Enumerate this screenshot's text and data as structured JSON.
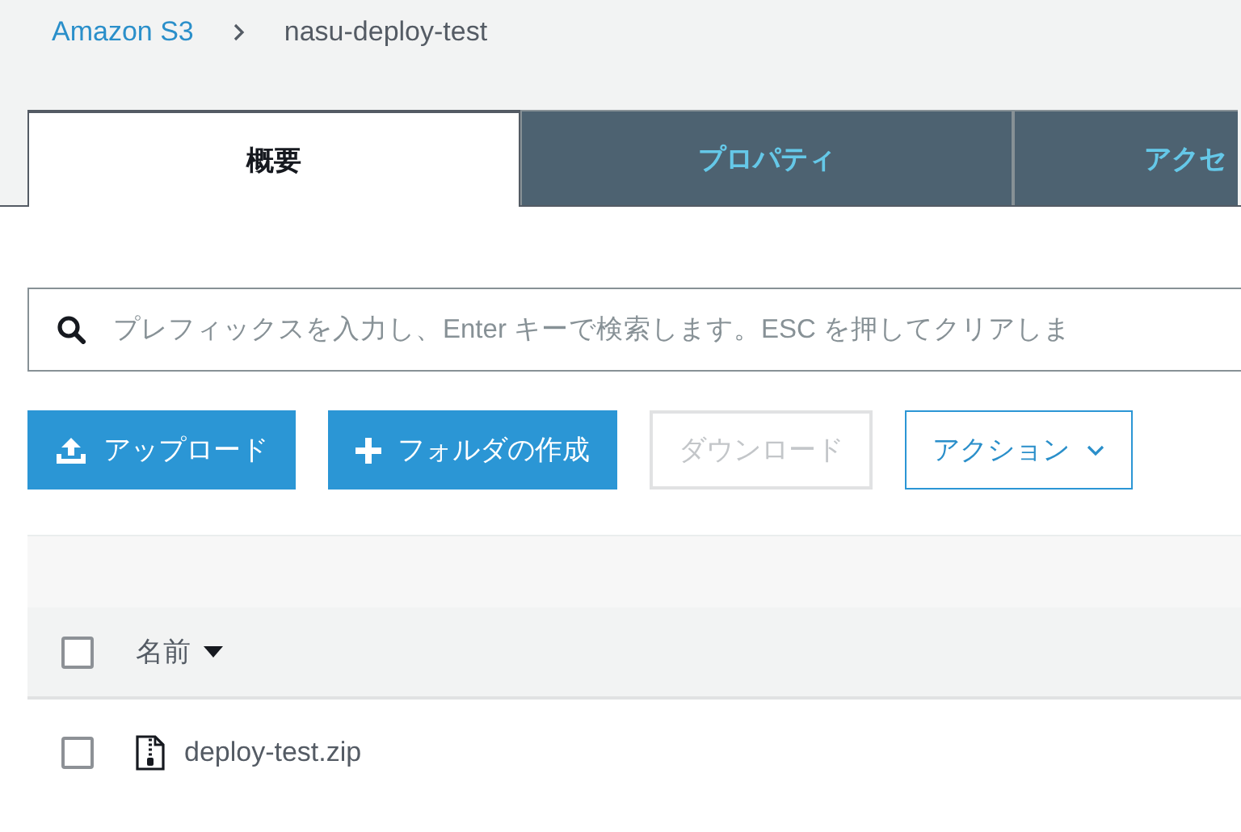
{
  "breadcrumb": [
    {
      "label": "Amazon S3",
      "kind": "link"
    },
    {
      "label": "nasu-deploy-test",
      "kind": "current"
    }
  ],
  "tabs": [
    {
      "label": "概要",
      "selected": true
    },
    {
      "label": "プロパティ",
      "selected": false
    },
    {
      "label": "アクセ",
      "selected": false
    }
  ],
  "search": {
    "placeholder": "プレフィックスを入力し、Enter キーで検索します。ESC を押してクリアしま"
  },
  "buttons": [
    {
      "label": "アップロード",
      "kind": "upload",
      "disabled": false
    },
    {
      "label": "フォルダの作成",
      "kind": "create",
      "disabled": false
    },
    {
      "label": "ダウンロード",
      "kind": "plain",
      "disabled": true
    },
    {
      "label": "アクション",
      "kind": "menu",
      "disabled": false
    }
  ],
  "table": {
    "select_all": {
      "checked": false
    },
    "columns": [
      {
        "label": "名前",
        "sorted": true
      }
    ],
    "rows": [
      {
        "name": "deploy-test.zip",
        "checked": false
      }
    ]
  }
}
